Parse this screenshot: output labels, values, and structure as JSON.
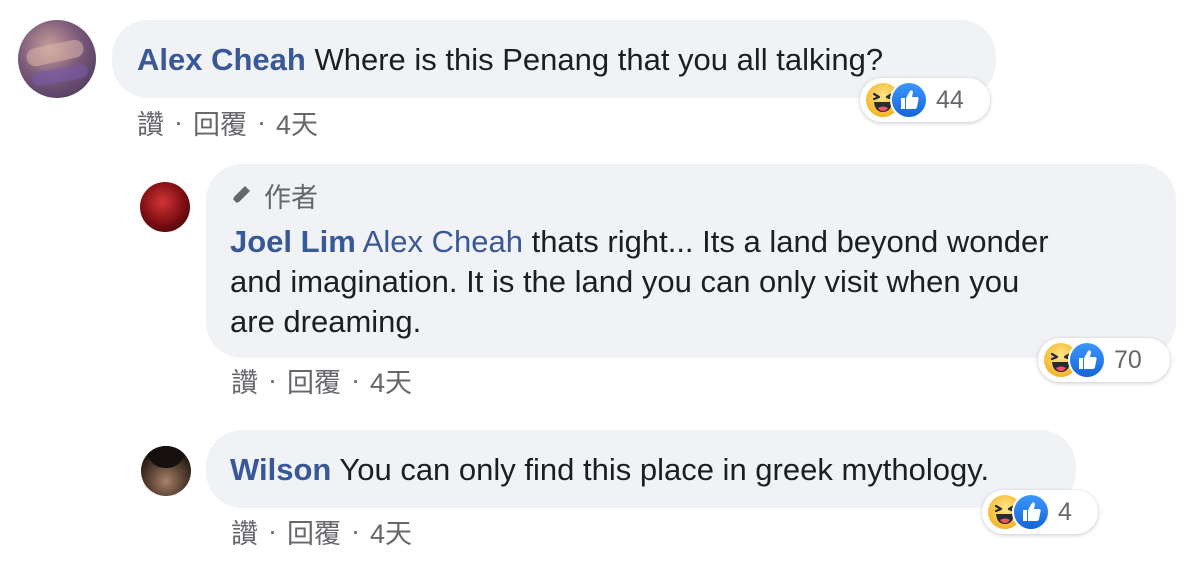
{
  "comments": [
    {
      "name": "Alex Cheah",
      "text": "Where is this Penang that you all talking?",
      "reaction_count": "44",
      "actions": {
        "like": "讚",
        "reply": "回覆",
        "time": "4天",
        "dot": "·"
      }
    },
    {
      "author_badge": "作者",
      "name": "Joel Lim",
      "mention": "Alex Cheah",
      "text_line1": "thats right... Its a land beyond wonder",
      "text_line2": "and imagination. It is the land you can only visit when you",
      "text_line3": "are dreaming.",
      "reaction_count": "70",
      "actions": {
        "like": "讚",
        "reply": "回覆",
        "time": "4天",
        "dot": "·"
      }
    },
    {
      "name": "Wilson",
      "text": "You can only find this place in greek mythology.",
      "reaction_count": "4",
      "actions": {
        "like": "讚",
        "reply": "回覆",
        "time": "4天",
        "dot": "·"
      }
    }
  ],
  "colors": {
    "name": "#385898",
    "bubble": "#f0f2f5",
    "meta": "#65676b",
    "haha": "#f7b125",
    "like": "#1877f2"
  },
  "icons": {
    "reaction_1": "haha-reaction-icon",
    "reaction_2": "like-reaction-icon",
    "author": "pencil-icon"
  }
}
